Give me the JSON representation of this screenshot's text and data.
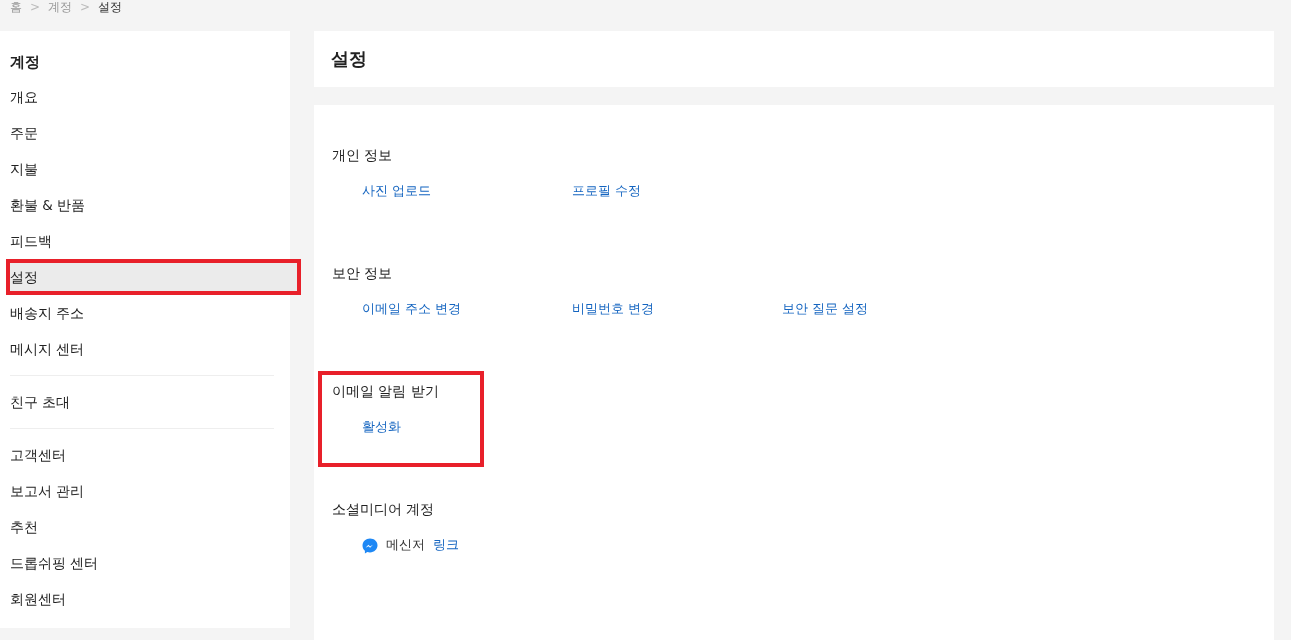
{
  "breadcrumb": [
    {
      "label": "홈",
      "current": false
    },
    {
      "label": "계정",
      "current": false
    },
    {
      "label": "설정",
      "current": true
    }
  ],
  "breadcrumb_separator": ">",
  "sidebar": {
    "title": "계정",
    "groups": [
      [
        {
          "label": "개요",
          "selected": false,
          "highlighted": false
        },
        {
          "label": "주문",
          "selected": false,
          "highlighted": false
        },
        {
          "label": "지불",
          "selected": false,
          "highlighted": false
        },
        {
          "label": "환불 & 반품",
          "selected": false,
          "highlighted": false
        },
        {
          "label": "피드백",
          "selected": false,
          "highlighted": false
        },
        {
          "label": "설정",
          "selected": true,
          "highlighted": true
        },
        {
          "label": "배송지 주소",
          "selected": false,
          "highlighted": false
        },
        {
          "label": "메시지 센터",
          "selected": false,
          "highlighted": false
        }
      ],
      [
        {
          "label": "친구 초대",
          "selected": false,
          "highlighted": false
        }
      ],
      [
        {
          "label": "고객센터",
          "selected": false,
          "highlighted": false
        },
        {
          "label": "보고서 관리",
          "selected": false,
          "highlighted": false
        },
        {
          "label": "추천",
          "selected": false,
          "highlighted": false
        },
        {
          "label": "드롭쉬핑 센터",
          "selected": false,
          "highlighted": false
        },
        {
          "label": "회원센터",
          "selected": false,
          "highlighted": false
        }
      ]
    ]
  },
  "page_title": "설정",
  "sections": [
    {
      "title": "개인 정보",
      "highlighted": false,
      "items": [
        {
          "kind": "link",
          "label": "사진 업로드"
        },
        {
          "kind": "link",
          "label": "프로필 수정"
        }
      ]
    },
    {
      "title": "보안 정보",
      "highlighted": false,
      "items": [
        {
          "kind": "link",
          "label": "이메일 주소 변경"
        },
        {
          "kind": "link",
          "label": "비밀번호 변경"
        },
        {
          "kind": "link",
          "label": "보안 질문 설정"
        }
      ]
    },
    {
      "title": "이메일 알림 받기",
      "highlighted": true,
      "items": [
        {
          "kind": "link",
          "label": "활성화"
        }
      ]
    },
    {
      "title": "소셜미디어 계정",
      "highlighted": false,
      "items": [
        {
          "kind": "social",
          "label": "메신저",
          "action": "링크"
        }
      ]
    }
  ]
}
